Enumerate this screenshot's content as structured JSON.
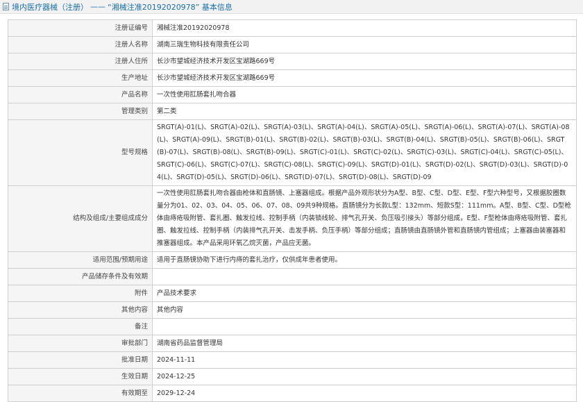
{
  "header": {
    "section": "境内医疗器械（注册）",
    "sep": "——",
    "title": "“湘械注准20192020978” 基本信息"
  },
  "rows": [
    {
      "label": "注册证编号",
      "value": "湘械注准20192020978"
    },
    {
      "label": "注册人名称",
      "value": "湖南三瑞生物科技有限责任公司"
    },
    {
      "label": "注册人住所",
      "value": "长沙市望城经济技术开发区宝湖路669号"
    },
    {
      "label": "生产地址",
      "value": "长沙市望城经济技术开发区宝湖路669号"
    },
    {
      "label": "产品名称",
      "value": "一次性使用肛肠套扎吻合器"
    },
    {
      "label": "管理类别",
      "value": "第二类"
    },
    {
      "label": "型号规格",
      "value": "SRGT(A)-01(L)、SRGT(A)-02(L)、SRGT(A)-03(L)、SRGT(A)-04(L)、SRGT(A)-05(L)、SRGT(A)-06(L)、SRGT(A)-07(L)、SRGT(A)-08(L)、SRGT(A)-09(L)、SRGT(B)-01(L)、SRGT(B)-02(L)、SRGT(B)-03(L)、SRGT(B)-04(L)、SRGT(B)-05(L)、SRGT(B)-06(L)、SRGT(B)-07(L)、SRGT(B)-08(L)、SRGT(B)-09(L)、SRGT(C)-01(L)、SRGT(C)-02(L)、SRGT(C)-03(L)、SRGT(C)-04(L)、SRGT(C)-05(L)、SRGT(C)-06(L)、SRGT(C)-07(L)、SRGT(C)-08(L)、SRGT(C)-09(L)、SRGT(D)-01(L)、SRGT(D)-02(L)、SRGT(D)-03(L)、SRGT(D)-04(L)、SRGT(D)-05(L)、SRGT(D)-06(L)、SRGT(D)-07(L)、SRGT(D)-08(L)、SRGT(D)-09"
    },
    {
      "label": "结构及组成/主要组成成分",
      "value": "一次性使用肛肠套扎吻合器由枪体和直肠镜、上塞器组成。根据产品外观形状分为A型、B型、C型、D型、E型、F型六种型号，又根据胶圈数量分为01、02、03、04、05、06、07、08、09共9种规格。直肠镜分为长款L型：132mm、短款S型：111mm。A型、B型、C型、D型枪体由痔疮吸附管、套扎圈、触发拉线、控制手柄（内装锁线轮、排气孔开关、负压吸引接头）等部分组成，E型、F型枪体由痔疮吸附管、套扎圈、触发拉线、控制手柄（内装排气孔开关、击发手柄、负压手柄）等部分组成；直肠镜由直肠镜外管和直肠镜内管组成；上塞器由装塞器和推塞器组成。本产品采用环氧乙烷灭菌，产品应无菌。"
    },
    {
      "label": "适用范围/预期用途",
      "value": "适用于直肠镜协助下进行内痔的套扎治疗，仅供成年患者使用。"
    },
    {
      "label": "产品储存条件及有效期",
      "value": ""
    },
    {
      "label": "附件",
      "value": "产品技术要求"
    },
    {
      "label": "其他内容",
      "value": "其他内容"
    },
    {
      "label": "备注",
      "value": ""
    },
    {
      "label": "审批部门",
      "value": "湖南省药品监督管理局"
    },
    {
      "label": "批准日期",
      "value": "2024-11-11"
    },
    {
      "label": "生效日期",
      "value": "2024-12-25"
    },
    {
      "label": "有效期至",
      "value": "2029-12-24"
    }
  ]
}
